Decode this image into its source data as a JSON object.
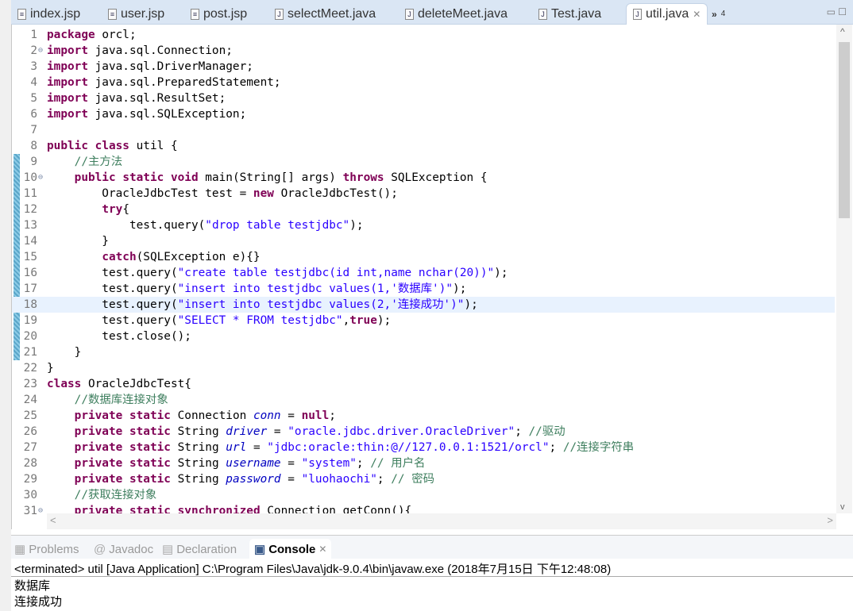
{
  "tabs": [
    {
      "label": "index.jsp",
      "icon": "jsp-file-icon"
    },
    {
      "label": "user.jsp",
      "icon": "jsp-file-icon"
    },
    {
      "label": "post.jsp",
      "icon": "jsp-file-icon"
    },
    {
      "label": "selectMeet.java",
      "icon": "java-file-icon"
    },
    {
      "label": "deleteMeet.java",
      "icon": "java-file-icon"
    },
    {
      "label": "Test.java",
      "icon": "java-file-icon"
    },
    {
      "label": "util.java",
      "icon": "java-file-icon",
      "active": true
    }
  ],
  "overflow": {
    "symbol": "»",
    "count": "4"
  },
  "editor": {
    "current_line": 18,
    "changed_lines": [
      9,
      21
    ],
    "folds": [
      2,
      10,
      31
    ],
    "lines": [
      [
        [
          "k",
          "package"
        ],
        [
          "p",
          " orcl;"
        ]
      ],
      [
        [
          "k",
          "import"
        ],
        [
          "p",
          " java.sql.Connection;"
        ]
      ],
      [
        [
          "k",
          "import"
        ],
        [
          "p",
          " java.sql.DriverManager;"
        ]
      ],
      [
        [
          "k",
          "import"
        ],
        [
          "p",
          " java.sql.PreparedStatement;"
        ]
      ],
      [
        [
          "k",
          "import"
        ],
        [
          "p",
          " java.sql.ResultSet;"
        ]
      ],
      [
        [
          "k",
          "import"
        ],
        [
          "p",
          " java.sql.SQLException;"
        ]
      ],
      [],
      [
        [
          "k",
          "public"
        ],
        [
          "p",
          " "
        ],
        [
          "k",
          "class"
        ],
        [
          "p",
          " util {"
        ]
      ],
      [
        [
          "c",
          "    //主方法"
        ]
      ],
      [
        [
          "p",
          "    "
        ],
        [
          "k",
          "public"
        ],
        [
          "p",
          " "
        ],
        [
          "k",
          "static"
        ],
        [
          "p",
          " "
        ],
        [
          "k",
          "void"
        ],
        [
          "p",
          " main(String[] args) "
        ],
        [
          "k",
          "throws"
        ],
        [
          "p",
          " SQLException {"
        ]
      ],
      [
        [
          "p",
          "        OracleJdbcTest test = "
        ],
        [
          "k",
          "new"
        ],
        [
          "p",
          " OracleJdbcTest();"
        ]
      ],
      [
        [
          "p",
          "        "
        ],
        [
          "k",
          "try"
        ],
        [
          "p",
          "{"
        ]
      ],
      [
        [
          "p",
          "            test.query("
        ],
        [
          "s",
          "\"drop table testjdbc\""
        ],
        [
          "p",
          ");"
        ]
      ],
      [
        [
          "p",
          "        }"
        ]
      ],
      [
        [
          "p",
          "        "
        ],
        [
          "k",
          "catch"
        ],
        [
          "p",
          "(SQLException e){}"
        ]
      ],
      [
        [
          "p",
          "        test.query("
        ],
        [
          "s",
          "\"create table testjdbc(id int,name nchar(20))\""
        ],
        [
          "p",
          ");"
        ]
      ],
      [
        [
          "p",
          "        test.query("
        ],
        [
          "s",
          "\"insert into testjdbc values(1,'数据库')\""
        ],
        [
          "p",
          ");"
        ]
      ],
      [
        [
          "p",
          "        test.query("
        ],
        [
          "s",
          "\"insert into testjdbc values(2,'连接成功')\""
        ],
        [
          "p",
          ");"
        ]
      ],
      [
        [
          "p",
          "        test.query("
        ],
        [
          "s",
          "\"SELECT * FROM testjdbc\""
        ],
        [
          "p",
          ","
        ],
        [
          "k",
          "true"
        ],
        [
          "p",
          ");"
        ]
      ],
      [
        [
          "p",
          "        test.close();"
        ]
      ],
      [
        [
          "p",
          "    }"
        ]
      ],
      [
        [
          "p",
          "}"
        ]
      ],
      [
        [
          "k",
          "class"
        ],
        [
          "p",
          " OracleJdbcTest{"
        ]
      ],
      [
        [
          "c",
          "    //数据库连接对象"
        ]
      ],
      [
        [
          "p",
          "    "
        ],
        [
          "k",
          "private"
        ],
        [
          "p",
          " "
        ],
        [
          "k",
          "static"
        ],
        [
          "p",
          " Connection "
        ],
        [
          "f",
          "conn"
        ],
        [
          "p",
          " = "
        ],
        [
          "k",
          "null"
        ],
        [
          "p",
          ";"
        ]
      ],
      [
        [
          "p",
          "    "
        ],
        [
          "k",
          "private"
        ],
        [
          "p",
          " "
        ],
        [
          "k",
          "static"
        ],
        [
          "p",
          " String "
        ],
        [
          "f",
          "driver"
        ],
        [
          "p",
          " = "
        ],
        [
          "s",
          "\"oracle.jdbc.driver.OracleDriver\""
        ],
        [
          "p",
          "; "
        ],
        [
          "c",
          "//驱动"
        ]
      ],
      [
        [
          "p",
          "    "
        ],
        [
          "k",
          "private"
        ],
        [
          "p",
          " "
        ],
        [
          "k",
          "static"
        ],
        [
          "p",
          " String "
        ],
        [
          "f",
          "url"
        ],
        [
          "p",
          " = "
        ],
        [
          "s",
          "\"jdbc:oracle:thin:@//127.0.0.1:1521/orcl\""
        ],
        [
          "p",
          "; "
        ],
        [
          "c",
          "//连接字符串"
        ]
      ],
      [
        [
          "p",
          "    "
        ],
        [
          "k",
          "private"
        ],
        [
          "p",
          " "
        ],
        [
          "k",
          "static"
        ],
        [
          "p",
          " String "
        ],
        [
          "f",
          "username"
        ],
        [
          "p",
          " = "
        ],
        [
          "s",
          "\"system\""
        ],
        [
          "p",
          "; "
        ],
        [
          "c",
          "// 用户名"
        ]
      ],
      [
        [
          "p",
          "    "
        ],
        [
          "k",
          "private"
        ],
        [
          "p",
          " "
        ],
        [
          "k",
          "static"
        ],
        [
          "p",
          " String "
        ],
        [
          "f",
          "password"
        ],
        [
          "p",
          " = "
        ],
        [
          "s",
          "\"luohaochi\""
        ],
        [
          "p",
          "; "
        ],
        [
          "c",
          "// 密码"
        ]
      ],
      [
        [
          "c",
          "    //获取连接对象"
        ]
      ],
      [
        [
          "p",
          "    "
        ],
        [
          "k",
          "private"
        ],
        [
          "p",
          " "
        ],
        [
          "k",
          "static"
        ],
        [
          "p",
          " "
        ],
        [
          "k",
          "synchronized"
        ],
        [
          "p",
          " Connection getConn(){"
        ]
      ]
    ]
  },
  "console": {
    "tabs": [
      {
        "label": "Problems",
        "icon": "problems-icon"
      },
      {
        "label": "Javadoc",
        "icon": "javadoc-icon"
      },
      {
        "label": "Declaration",
        "icon": "declaration-icon"
      },
      {
        "label": "Console",
        "icon": "console-icon",
        "active": true
      }
    ],
    "info": "<terminated> util [Java Application] C:\\Program Files\\Java\\jdk-9.0.4\\bin\\javaw.exe (2018年7月15日 下午12:48:08)",
    "output": [
      "数据库",
      "连接成功"
    ]
  },
  "colors": {
    "keyword": "#7f0055",
    "string": "#2a00ff",
    "comment": "#3f7f5f",
    "field": "#0000c0",
    "current_line": "#e8f2fe"
  }
}
